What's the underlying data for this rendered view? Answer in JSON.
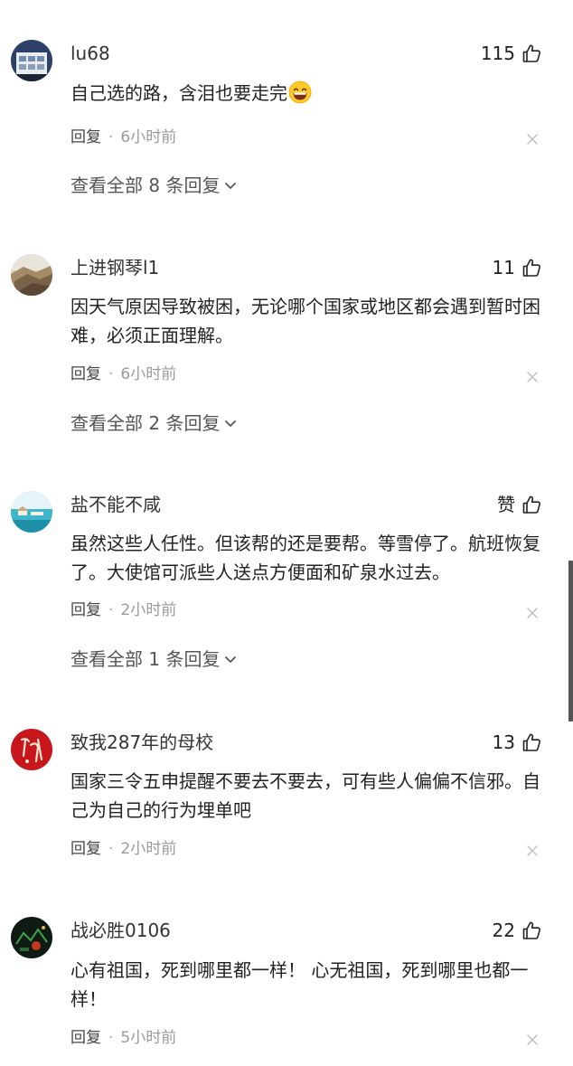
{
  "comments": [
    {
      "username": "lu68",
      "likes": "115",
      "content": "自己选的路，含泪也要走完",
      "emoji": "grinning-face-emoji",
      "reply_label": "回复",
      "separator": "·",
      "time": "6小时前",
      "view_all": "查看全部 8 条回复"
    },
    {
      "username": "上进钢琴l1",
      "likes": "11",
      "content": "因天气原因导致被困，无论哪个国家或地区都会遇到暂时困难，必须正面理解。",
      "reply_label": "回复",
      "separator": "·",
      "time": "6小时前",
      "view_all": "查看全部 2 条回复"
    },
    {
      "username": "盐不能不咸",
      "likes": "赞",
      "content": "虽然这些人任性。但该帮的还是要帮。等雪停了。航班恢复了。大使馆可派些人送点方便面和矿泉水过去。",
      "reply_label": "回复",
      "separator": "·",
      "time": "2小时前",
      "view_all": "查看全部 1 条回复"
    },
    {
      "username": "致我287年的母校",
      "likes": "13",
      "content": "国家三令五申提醒不要去不要去，可有些人偏偏不信邪。自己为自己的行为埋单吧",
      "reply_label": "回复",
      "separator": "·",
      "time": "2小时前"
    },
    {
      "username": "战必胜0106",
      "likes": "22",
      "content": "心有祖国，死到哪里都一样！ 心无祖国，死到哪里也都一样！",
      "reply_label": "回复",
      "separator": "·",
      "time": "5小时前"
    }
  ],
  "icons": {
    "like": "thumbs-up-icon",
    "close": "close-icon",
    "chevron": "chevron-down-icon"
  }
}
